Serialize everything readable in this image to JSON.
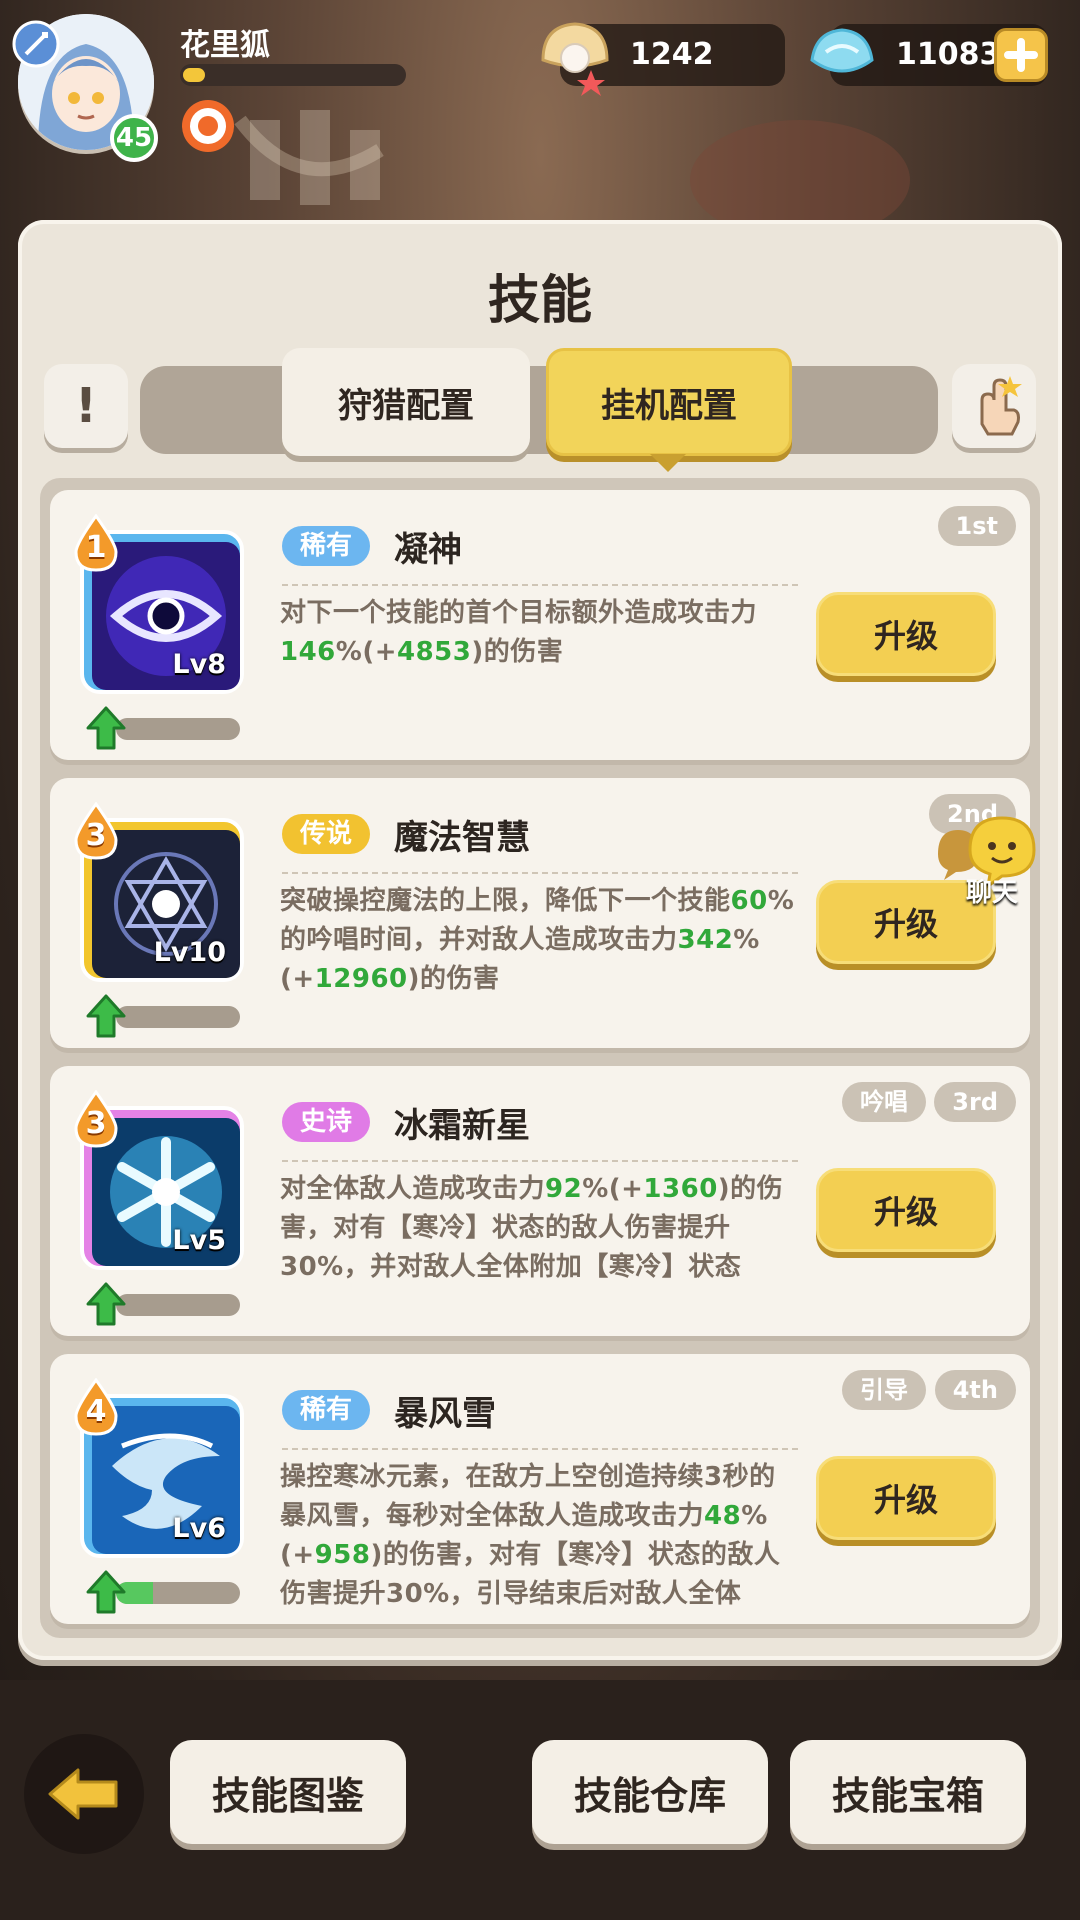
{
  "player": {
    "name": "花里狐",
    "level": "45",
    "exp_fraction": 0.1
  },
  "currencies": {
    "pearls": "1242",
    "crystals": "11083"
  },
  "panel": {
    "title": "技能"
  },
  "tabs": [
    {
      "label": "狩猎配置",
      "selected": false
    },
    {
      "label": "挂机配置",
      "selected": true
    }
  ],
  "skills": [
    {
      "slot": "1",
      "rarity": "稀有",
      "rarity_color": "#6cb6f0",
      "name": "凝神",
      "level": "Lv8",
      "order": "1st",
      "tag": "",
      "frame_color": "#5ab6ee",
      "progress": 0.0,
      "desc": [
        [
          "t",
          "对下一个技能的首个目标额外造成攻击力"
        ],
        [
          "g",
          "146"
        ],
        [
          "t",
          "%(+"
        ],
        [
          "g",
          "4853"
        ],
        [
          "t",
          ")的伤害"
        ]
      ]
    },
    {
      "slot": "3",
      "rarity": "传说",
      "rarity_color": "#f2c230",
      "name": "魔法智慧",
      "level": "Lv10",
      "order": "2nd",
      "tag": "",
      "frame_color": "#f2c62e",
      "progress": 0.0,
      "desc": [
        [
          "t",
          "突破操控魔法的上限，降低下一个技能"
        ],
        [
          "g",
          "60"
        ],
        [
          "t",
          "%的吟唱时间，并对敌人造成攻击力"
        ],
        [
          "g",
          "342"
        ],
        [
          "t",
          "%(+"
        ],
        [
          "g",
          "12960"
        ],
        [
          "t",
          ")的伤害"
        ]
      ]
    },
    {
      "slot": "3",
      "rarity": "史诗",
      "rarity_color": "#e07be6",
      "name": "冰霜新星",
      "level": "Lv5",
      "order": "3rd",
      "tag": "吟唱",
      "frame_color": "#e482e6",
      "progress": 0.0,
      "desc": [
        [
          "t",
          "对全体敌人造成攻击力"
        ],
        [
          "g",
          "92"
        ],
        [
          "t",
          "%(+"
        ],
        [
          "g",
          "1360"
        ],
        [
          "t",
          ")的伤害，对有【寒冷】状态的敌人伤害提升30%，并对敌人全体附加【寒冷】状态"
        ]
      ]
    },
    {
      "slot": "4",
      "rarity": "稀有",
      "rarity_color": "#6cb6f0",
      "name": "暴风雪",
      "level": "Lv6",
      "order": "4th",
      "tag": "引导",
      "frame_color": "#5ab6ee",
      "progress": 0.3,
      "desc": [
        [
          "t",
          "操控寒冰元素，在敌方上空创造持续3秒的暴风雪，每秒对全体敌人造成攻击力"
        ],
        [
          "g",
          "48"
        ],
        [
          "t",
          "%(+"
        ],
        [
          "g",
          "958"
        ],
        [
          "t",
          ")的伤害，对有【寒冷】状态的敌人伤害提升30%，引导结束后对敌人全体"
        ]
      ]
    }
  ],
  "upgrade_label": "升级",
  "chat_label": "聊天",
  "bottom": {
    "codex": "技能图鉴",
    "storage": "技能仓库",
    "chest": "技能宝箱"
  }
}
